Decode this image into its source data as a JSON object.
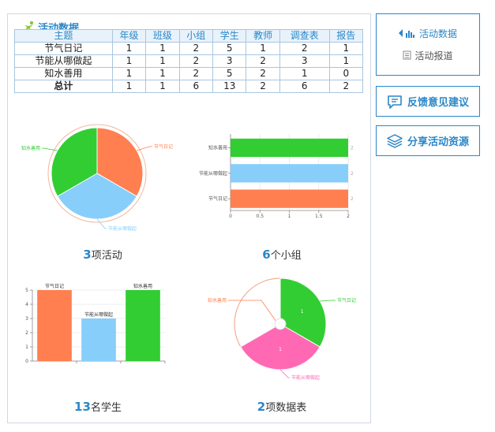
{
  "panel": {
    "title": "活动数据"
  },
  "table": {
    "headers": [
      "主题",
      "年级",
      "班级",
      "小组",
      "学生",
      "教师",
      "调查表",
      "报告"
    ],
    "rows": [
      [
        "节气日记",
        "1",
        "1",
        "2",
        "5",
        "1",
        "2",
        "1"
      ],
      [
        "节能从哪做起",
        "1",
        "1",
        "2",
        "3",
        "2",
        "3",
        "1"
      ],
      [
        "知水善用",
        "1",
        "1",
        "2",
        "5",
        "2",
        "1",
        "0"
      ]
    ],
    "total": [
      "总计",
      "1",
      "1",
      "6",
      "13",
      "2",
      "6",
      "2"
    ]
  },
  "captions": {
    "activities": {
      "num": "3",
      "text": "项活动"
    },
    "groups": {
      "num": "6",
      "text": "个小组"
    },
    "students": {
      "num": "13",
      "text": "名学生"
    },
    "surveys": {
      "num": "2",
      "text": "项数据表"
    }
  },
  "colors": {
    "accent": "#2a87c8",
    "orange": "#ff7f50",
    "lightblue": "#87cefa",
    "green": "#32cd32",
    "pink": "#ff69b4"
  },
  "chart_data": [
    {
      "type": "pie",
      "labels": [
        "节气日记",
        "节能从哪做起",
        "知水善用"
      ],
      "values": [
        1,
        1,
        1
      ],
      "colors": [
        "#ff7f50",
        "#87cefa",
        "#32cd32"
      ]
    },
    {
      "type": "bar",
      "orientation": "horizontal",
      "categories": [
        "知水善用",
        "节能从哪做起",
        "节气日记"
      ],
      "values": [
        2,
        2,
        2
      ],
      "colors": [
        "#32cd32",
        "#87cefa",
        "#ff7f50"
      ],
      "xlim": [
        0,
        2
      ],
      "xticks": [
        "0",
        "0.5",
        "1",
        "1.5",
        "2"
      ],
      "data_labels": [
        "2",
        "2",
        "2"
      ]
    },
    {
      "type": "bar",
      "categories": [
        "节气日记",
        "节能从哪做起",
        "知水善用"
      ],
      "values": [
        5,
        3,
        5
      ],
      "colors": [
        "#ff7f50",
        "#87cefa",
        "#32cd32"
      ],
      "ylim": [
        0,
        5
      ],
      "yticks": [
        "0",
        "1",
        "2",
        "3",
        "4",
        "5"
      ]
    },
    {
      "type": "pie",
      "labels": [
        "节气日记",
        "节能从哪做起",
        "知水善用"
      ],
      "values": [
        1,
        1,
        0
      ],
      "colors": [
        "#32cd32",
        "#ff69b4",
        "#ff7f50"
      ],
      "data_labels": [
        "1",
        "1"
      ]
    }
  ],
  "sidebar": {
    "menu": {
      "active_label": "活动数据",
      "inactive_label": "活动报道"
    },
    "feedback_label": "反馈意见建议",
    "share_label": "分享活动资源"
  }
}
